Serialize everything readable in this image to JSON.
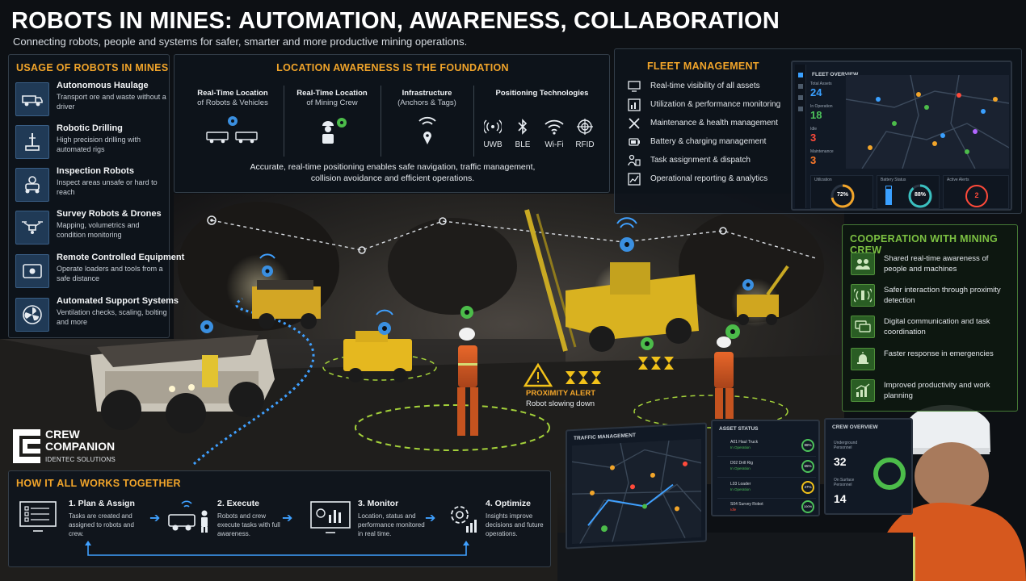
{
  "header": {
    "title_part1": "ROBOTS IN MINES:",
    "title_part2": "AUTOMATION, AWARENESS, COLLABORATION",
    "subtitle": "Connecting robots, people and systems for safer, smarter and more productive mining operations."
  },
  "usage": {
    "title": "USAGE OF ROBOTS IN MINES",
    "items": [
      {
        "title": "Autonomous Haulage",
        "desc": "Transport ore and waste without a driver",
        "icon": "haul-truck-icon"
      },
      {
        "title": "Robotic Drilling",
        "desc": "High precision drilling with automated rigs",
        "icon": "drill-rig-icon"
      },
      {
        "title": "Inspection Robots",
        "desc": "Inspect areas unsafe or hard to reach",
        "icon": "inspection-robot-icon"
      },
      {
        "title": "Survey Robots & Drones",
        "desc": "Mapping, volumetrics and condition monitoring",
        "icon": "drone-icon"
      },
      {
        "title": "Remote Controlled Equipment",
        "desc": "Operate loaders and tools from a safe distance",
        "icon": "remote-control-icon"
      },
      {
        "title": "Automated Support Systems",
        "desc": "Ventilation checks, scaling, bolting and more",
        "icon": "ventilation-fan-icon"
      }
    ]
  },
  "location": {
    "title": "LOCATION AWARENESS IS THE FOUNDATION",
    "columns": [
      {
        "h": "Real-Time Location",
        "s": "of Robots & Vehicles"
      },
      {
        "h": "Real-Time Location",
        "s": "of Mining Crew"
      },
      {
        "h": "Infrastructure",
        "s": "(Anchors & Tags)"
      },
      {
        "h": "Positioning Technologies",
        "s": ""
      }
    ],
    "technologies": [
      "UWB",
      "BLE",
      "Wi-Fi",
      "RFID"
    ],
    "caption_line1": "Accurate, real-time positioning enables safe navigation, traffic management,",
    "caption_line2": "collision avoidance and efficient operations."
  },
  "fleet": {
    "title": "FLEET MANAGEMENT",
    "items": [
      {
        "label": "Real-time visibility of all assets",
        "icon": "monitor-icon"
      },
      {
        "label": "Utilization & performance monitoring",
        "icon": "chart-icon"
      },
      {
        "label": "Maintenance & health management",
        "icon": "wrench-icon"
      },
      {
        "label": "Battery & charging management",
        "icon": "battery-icon"
      },
      {
        "label": "Task assignment & dispatch",
        "icon": "dispatch-icon"
      },
      {
        "label": "Operational reporting & analytics",
        "icon": "analytics-icon"
      }
    ],
    "dashboard": {
      "title": "FLEET OVERVIEW",
      "stats": [
        {
          "label": "Total Assets",
          "value": "24",
          "color": "#3aa0ff"
        },
        {
          "label": "In Operation",
          "value": "18",
          "color": "#4cc25a"
        },
        {
          "label": "Idle",
          "value": "3",
          "color": "#ff4a3a"
        },
        {
          "label": "Maintenance",
          "value": "3",
          "color": "#ff7a2a"
        }
      ],
      "utilization_label": "Utilization",
      "utilization_value": "72%",
      "utilization_fraction": 0.72,
      "battery_label": "Battery Status",
      "battery_value": "88%",
      "battery_fraction": 0.88,
      "alerts_label": "Active Alerts",
      "alerts_value": "2"
    }
  },
  "cooperation": {
    "title": "COOPERATION WITH MINING CREW",
    "items": [
      {
        "text": "Shared real-time awareness of people and machines",
        "icon": "people-icon"
      },
      {
        "text": "Safer interaction through proximity detection",
        "icon": "proximity-icon"
      },
      {
        "text": "Digital communication and task coordination",
        "icon": "chat-icon"
      },
      {
        "text": "Faster response in emergencies",
        "icon": "alarm-bell-icon"
      },
      {
        "text": "Improved productivity and work planning",
        "icon": "growth-chart-icon"
      }
    ]
  },
  "alert": {
    "title": "PROXIMITY ALERT",
    "text": "Robot slowing down"
  },
  "logo": {
    "line1": "CREW",
    "line2": "COMPANION",
    "line3": "IDENTEC SOLUTIONS"
  },
  "how": {
    "title": "HOW IT ALL WORKS TOGETHER",
    "steps": [
      {
        "h": "1. Plan & Assign",
        "d": "Tasks are created and assigned to robots and crew.",
        "icon": "checklist-screen-icon"
      },
      {
        "h": "2. Execute",
        "d": "Robots and crew execute tasks with full awareness.",
        "icon": "vehicle-worker-icon"
      },
      {
        "h": "3. Monitor",
        "d": "Location, status and performance monitored in real time.",
        "icon": "monitor-screen-icon"
      },
      {
        "h": "4. Optimize",
        "d": "Insights improve decisions and future operations.",
        "icon": "gear-chart-icon"
      }
    ]
  },
  "screens": {
    "traffic_title": "TRAFFIC MANAGEMENT",
    "asset_title": "ASSET STATUS",
    "assets": [
      {
        "name": "A01 Haul Truck",
        "status": "In Operation",
        "pct": "88%"
      },
      {
        "name": "D02 Drill Rig",
        "status": "In Operation",
        "pct": "65%"
      },
      {
        "name": "L03 Loader",
        "status": "In Operation",
        "pct": "47%"
      },
      {
        "name": "S04 Survey Robot",
        "status": "Idle",
        "pct": "100%"
      }
    ],
    "crew_title": "CREW OVERVIEW",
    "crew_underground_label": "Underground Personnel",
    "crew_underground": "32",
    "crew_surface_label": "On Surface Personnel",
    "crew_surface": "14"
  },
  "colors": {
    "accent_orange": "#f2a52a",
    "accent_green": "#7cc142",
    "map_pin_blue": "#3a8fe0",
    "map_pin_green": "#4cbc4a",
    "alert_yellow": "#f2c21a"
  }
}
